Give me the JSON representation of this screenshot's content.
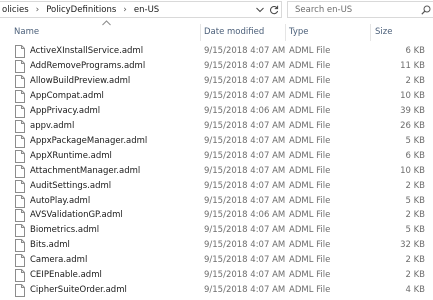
{
  "address": {
    "breadcrumb": [
      "olicies",
      "PolicyDefinitions",
      "en-US"
    ],
    "separator": "›",
    "dropdown_icon": "chevron-down-icon",
    "refresh_icon": "refresh-icon"
  },
  "search": {
    "placeholder": "Search en-US",
    "icon": "search-icon"
  },
  "columns": {
    "name": "Name",
    "date": "Date modified",
    "type": "Type",
    "size": "Size"
  },
  "files": [
    {
      "name": "ActiveXInstallService.adml",
      "date": "9/15/2018 4:07 AM",
      "type": "ADML File",
      "size": "6 KB"
    },
    {
      "name": "AddRemovePrograms.adml",
      "date": "9/15/2018 4:07 AM",
      "type": "ADML File",
      "size": "11 KB"
    },
    {
      "name": "AllowBuildPreview.adml",
      "date": "9/15/2018 4:07 AM",
      "type": "ADML File",
      "size": "2 KB"
    },
    {
      "name": "AppCompat.adml",
      "date": "9/15/2018 4:07 AM",
      "type": "ADML File",
      "size": "10 KB"
    },
    {
      "name": "AppPrivacy.adml",
      "date": "9/15/2018 4:06 AM",
      "type": "ADML File",
      "size": "39 KB"
    },
    {
      "name": "appv.adml",
      "date": "9/15/2018 4:07 AM",
      "type": "ADML File",
      "size": "26 KB"
    },
    {
      "name": "AppxPackageManager.adml",
      "date": "9/15/2018 4:07 AM",
      "type": "ADML File",
      "size": "5 KB"
    },
    {
      "name": "AppXRuntime.adml",
      "date": "9/15/2018 4:07 AM",
      "type": "ADML File",
      "size": "6 KB"
    },
    {
      "name": "AttachmentManager.adml",
      "date": "9/15/2018 4:07 AM",
      "type": "ADML File",
      "size": "10 KB"
    },
    {
      "name": "AuditSettings.adml",
      "date": "9/15/2018 4:07 AM",
      "type": "ADML File",
      "size": "2 KB"
    },
    {
      "name": "AutoPlay.adml",
      "date": "9/15/2018 4:07 AM",
      "type": "ADML File",
      "size": "5 KB"
    },
    {
      "name": "AVSValidationGP.adml",
      "date": "9/15/2018 4:06 AM",
      "type": "ADML File",
      "size": "2 KB"
    },
    {
      "name": "Biometrics.adml",
      "date": "9/15/2018 4:07 AM",
      "type": "ADML File",
      "size": "5 KB"
    },
    {
      "name": "Bits.adml",
      "date": "9/15/2018 4:07 AM",
      "type": "ADML File",
      "size": "32 KB"
    },
    {
      "name": "Camera.adml",
      "date": "9/15/2018 4:07 AM",
      "type": "ADML File",
      "size": "2 KB"
    },
    {
      "name": "CEIPEnable.adml",
      "date": "9/15/2018 4:07 AM",
      "type": "ADML File",
      "size": "2 KB"
    },
    {
      "name": "CipherSuiteOrder.adml",
      "date": "9/15/2018 4:07 AM",
      "type": "ADML File",
      "size": "4 KB"
    }
  ]
}
